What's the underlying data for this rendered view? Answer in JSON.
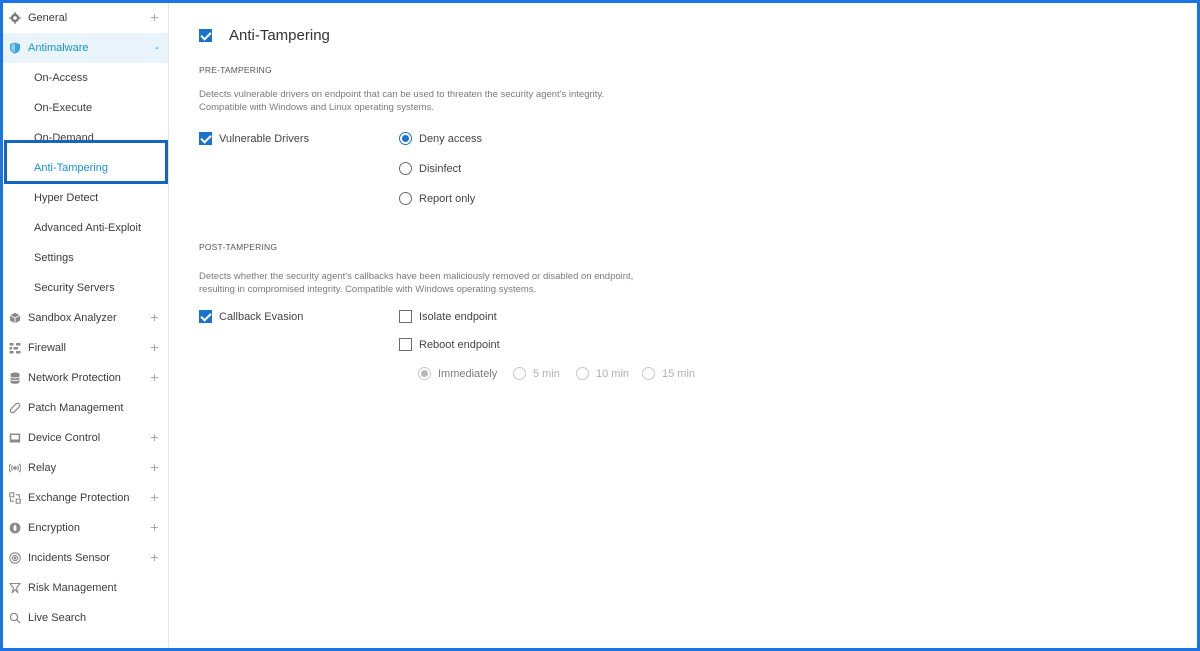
{
  "sidebar": {
    "items": [
      {
        "label": "General",
        "icon": "gear-icon",
        "expand": "+"
      },
      {
        "label": "Antimalware",
        "icon": "shield-icon",
        "expand": "-"
      },
      {
        "label": "Sandbox Analyzer",
        "icon": "cube-icon",
        "expand": "+"
      },
      {
        "label": "Firewall",
        "icon": "firewall-icon",
        "expand": "+"
      },
      {
        "label": "Network Protection",
        "icon": "database-icon",
        "expand": "+"
      },
      {
        "label": "Patch Management",
        "icon": "patch-icon"
      },
      {
        "label": "Device Control",
        "icon": "device-icon",
        "expand": "+"
      },
      {
        "label": "Relay",
        "icon": "relay-icon",
        "expand": "+"
      },
      {
        "label": "Exchange Protection",
        "icon": "exchange-icon",
        "expand": "+"
      },
      {
        "label": "Encryption",
        "icon": "lock-icon",
        "expand": "+"
      },
      {
        "label": "Incidents Sensor",
        "icon": "sensor-icon",
        "expand": "+"
      },
      {
        "label": "Risk Management",
        "icon": "risk-icon"
      },
      {
        "label": "Live Search",
        "icon": "search-icon"
      }
    ],
    "antimalware_sub": [
      {
        "label": "On-Access"
      },
      {
        "label": "On-Execute"
      },
      {
        "label": "On-Demand"
      },
      {
        "label": "Anti-Tampering"
      },
      {
        "label": "Hyper Detect"
      },
      {
        "label": "Advanced Anti-Exploit"
      },
      {
        "label": "Settings"
      },
      {
        "label": "Security Servers"
      }
    ]
  },
  "main": {
    "title": "Anti-Tampering",
    "pre": {
      "heading": "PRE-TAMPERING",
      "desc1": "Detects vulnerable drivers on endpoint that can be used to threaten the security agent's integrity.",
      "desc2": "Compatible with Windows and Linux operating systems.",
      "checkbox_label": "Vulnerable Drivers",
      "options": [
        "Deny access",
        "Disinfect",
        "Report only"
      ],
      "selected": "Deny access"
    },
    "post": {
      "heading": "POST-TAMPERING",
      "desc1": "Detects whether the security agent's callbacks have been maliciously removed or disabled on endpoint,",
      "desc2": "resulting in compromised integrity. Compatible with Windows operating systems.",
      "checkbox_label": "Callback Evasion",
      "isolate_label": "Isolate endpoint",
      "reboot_label": "Reboot endpoint",
      "reboot_options": [
        "Immediately",
        "5 min",
        "10 min",
        "15 min"
      ]
    }
  },
  "colors": {
    "accent": "#1a73c8",
    "selection_frame": "#1565c0",
    "outer_frame": "#1b74e4",
    "active_bg": "#eaf4fb"
  }
}
